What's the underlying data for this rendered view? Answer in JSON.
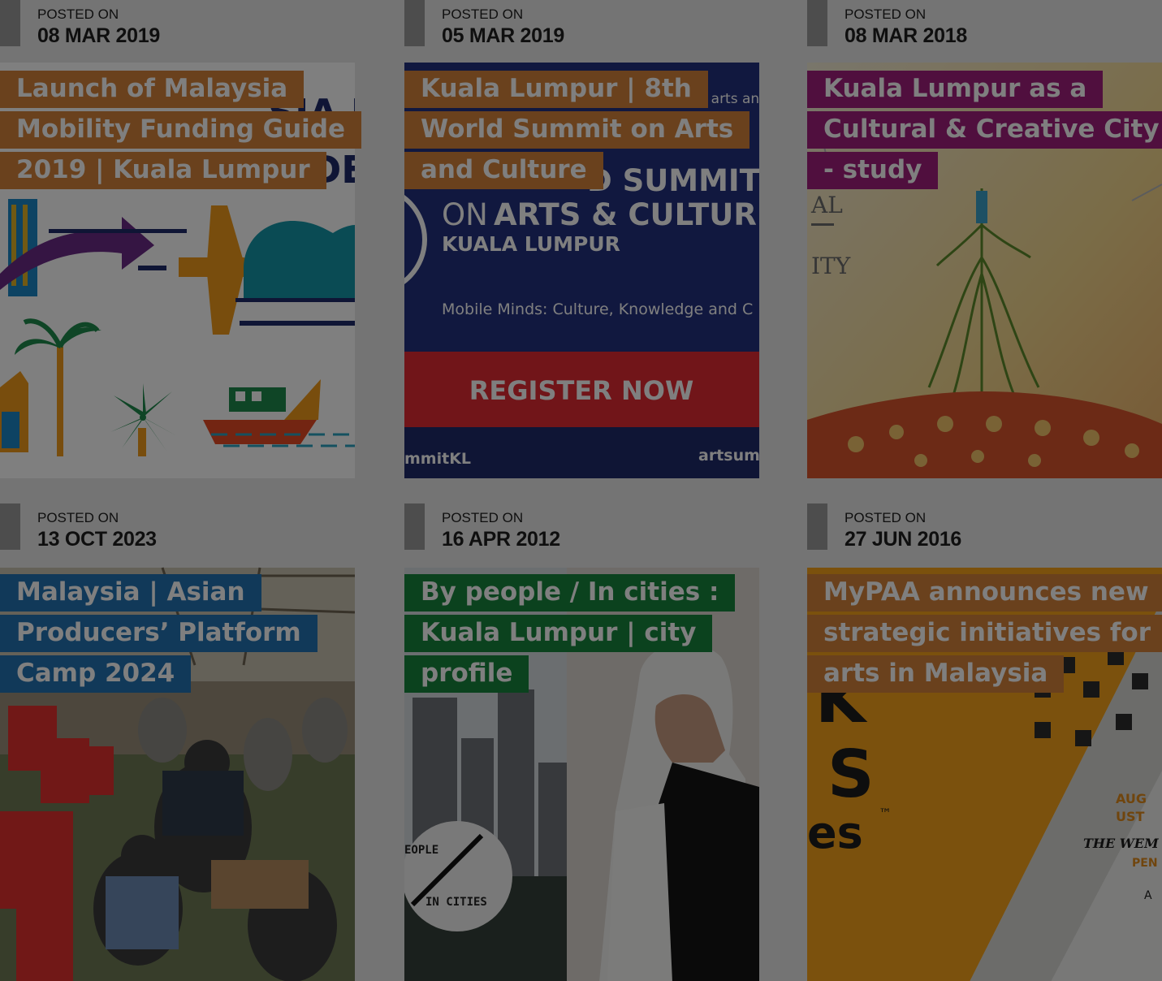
{
  "posted_label": "POSTED ON",
  "cards": [
    {
      "date": "08 MAR 2019",
      "title": "Launch of Malaysia Mobility Funding Guide 2019 | Kuala Lumpur",
      "tag_color": "#d4833b"
    },
    {
      "date": "05 MAR 2019",
      "title": "Kuala Lumpur | 8th World Summit on Arts and Culture",
      "tag_color": "#d4833b"
    },
    {
      "date": "08 MAR 2018",
      "title": "Kuala Lumpur as a Cultural & Creative City - study",
      "tag_color": "#a01e7c"
    },
    {
      "date": "13 OCT 2023",
      "title": "Malaysia | Asian Producers’ Platform Camp 2024",
      "tag_color": "#2273b3"
    },
    {
      "date": "16 APR 2012",
      "title": "By people / In cities : Kuala Lumpur | city profile",
      "tag_color": "#17843c"
    },
    {
      "date": "27 JUN 2016",
      "title": "MyPAA announces new strategic initiatives for arts in Malaysia",
      "tag_color": "#d4833b"
    }
  ],
  "images": {
    "mobility": {
      "text_fragment": "SIA M",
      "text_fragment2": "IDE"
    },
    "summit": {
      "top_text": "e of arts an",
      "headline1": "D SUMMIT",
      "headline2_prefix": "ON ",
      "headline2": "ARTS & CULTURE",
      "city": "KUALA LUMPUR",
      "tagline": "Mobile Minds: Culture, Knowledge and C",
      "cta": "REGISTER NOW",
      "hashtag": "mmitKL",
      "site": "artsum"
    },
    "creative": {
      "frag1": "AL",
      "frag2": "ITY"
    },
    "people": {
      "line1": "EOPLE",
      "line2": "IN CITIES"
    },
    "mypaa": {
      "big1": "K",
      "big2": "S",
      "big3": "es",
      "tm": "™",
      "small1": "AUG",
      "small2": "UST",
      "small3": "THE WEM",
      "small4": "PEN",
      "small5": "A"
    }
  }
}
